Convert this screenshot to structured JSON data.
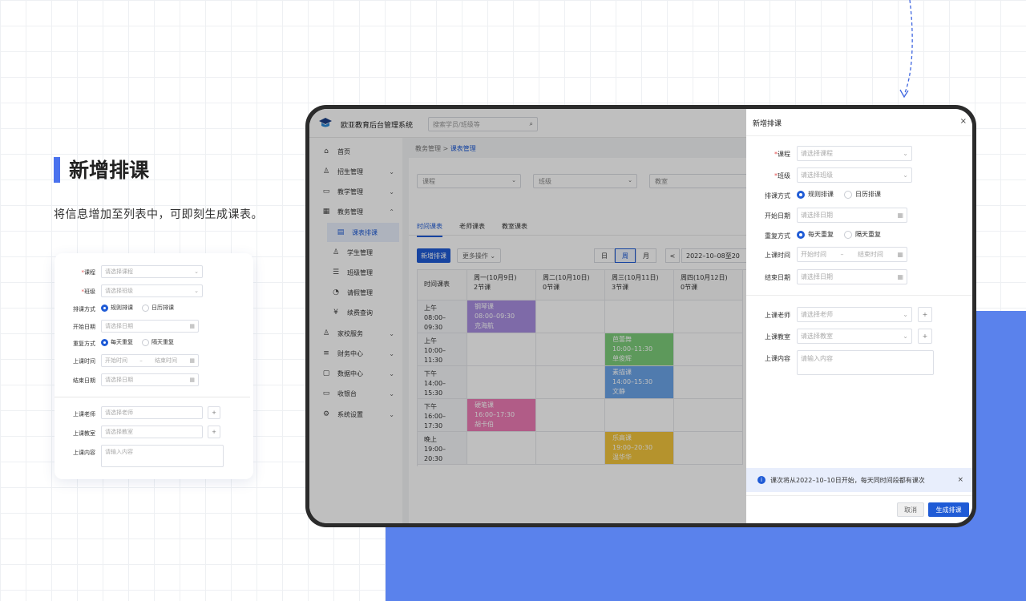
{
  "hero": {
    "title": "新增排课",
    "subtitle": "将信息增加至列表中，可即刻生成课表。"
  },
  "form": {
    "course_label": "课程",
    "course_ph": "请选择课程",
    "class_label": "班级",
    "class_ph": "请选择班级",
    "mode_label": "排课方式",
    "mode_rule": "规则排课",
    "mode_cal": "日历排课",
    "start_label": "开始日期",
    "start_ph": "请选择日期",
    "repeat_label": "重复方式",
    "repeat_daily": "每天重复",
    "repeat_alt": "隔天重复",
    "time_label": "上课时间",
    "time_start_ph": "开始时间",
    "time_sep": "–",
    "time_end_ph": "结束时间",
    "end_label": "结束日期",
    "end_ph": "请选择日期",
    "teacher_label": "上课老师",
    "teacher_ph": "请选择老师",
    "room_label": "上课教室",
    "room_ph": "请选择教室",
    "content_label": "上课内容",
    "content_ph": "请输入内容",
    "required_mark": "*",
    "plus": "+"
  },
  "app": {
    "name": "欧亚教育后台管理系统",
    "search_ph": "搜索学员/班级等",
    "nav": [
      {
        "label": "首页",
        "icon": "home-icon",
        "glyph": "⌂"
      },
      {
        "label": "招生管理",
        "icon": "user-add-icon",
        "glyph": "♙"
      },
      {
        "label": "教学管理",
        "icon": "book-icon",
        "glyph": "▭"
      },
      {
        "label": "教务管理",
        "icon": "blocks-icon",
        "glyph": "▦"
      },
      {
        "label": "课表排课",
        "icon": "calendar-icon",
        "glyph": "▤"
      },
      {
        "label": "学生管理",
        "icon": "person-icon",
        "glyph": "♙"
      },
      {
        "label": "班级管理",
        "icon": "list-icon",
        "glyph": "☰"
      },
      {
        "label": "请假管理",
        "icon": "leave-icon",
        "glyph": "◔"
      },
      {
        "label": "续费查询",
        "icon": "yen-icon",
        "glyph": "¥"
      },
      {
        "label": "家校服务",
        "icon": "group-icon",
        "glyph": "♙"
      },
      {
        "label": "财务中心",
        "icon": "database-icon",
        "glyph": "≡"
      },
      {
        "label": "数据中心",
        "icon": "frame-icon",
        "glyph": "▢"
      },
      {
        "label": "收银台",
        "icon": "monitor-icon",
        "glyph": "▭"
      },
      {
        "label": "系统设置",
        "icon": "gear-icon",
        "glyph": "⚙"
      }
    ],
    "breadcrumb_root": "教务管理",
    "breadcrumb_sep": ">",
    "breadcrumb_current": "课表管理",
    "filter_course": "课程",
    "filter_class": "班级",
    "filter_room": "教室",
    "tabs": [
      "时间课表",
      "老师课表",
      "教室课表"
    ],
    "new_btn": "新增排课",
    "more_btn": "更多操作",
    "views": [
      "日",
      "周",
      "月"
    ],
    "prev": "<",
    "date_range": "2022–10–08至20",
    "table_header": "时间课表",
    "days": [
      {
        "name": "周一(10月9日)",
        "count": "2节课"
      },
      {
        "name": "周二(10月10日)",
        "count": "0节课"
      },
      {
        "name": "周三(10月11日)",
        "count": "3节课"
      },
      {
        "name": "周四(10月12日)",
        "count": "0节课"
      }
    ],
    "slots": [
      {
        "period": "上午",
        "time": "08:00–09:30"
      },
      {
        "period": "上午",
        "time": "10:00–11:30"
      },
      {
        "period": "下午",
        "time": "14:00–15:30"
      },
      {
        "period": "下午",
        "time": "16:00–17:30"
      },
      {
        "period": "晚上",
        "time": "19:00–20:30"
      }
    ],
    "events": [
      {
        "name": "钢琴课",
        "time": "08:00–09:30",
        "teacher": "克海航",
        "color": "#a88ee0",
        "day": 0,
        "slot": 0
      },
      {
        "name": "芭蕾舞",
        "time": "10:00–11:30",
        "teacher": "单俊辉",
        "color": "#7ccc7a",
        "day": 2,
        "slot": 1
      },
      {
        "name": "素描课",
        "time": "14:00–15:30",
        "teacher": "文静",
        "color": "#6ba4e9",
        "day": 2,
        "slot": 2
      },
      {
        "name": "硬笔课",
        "time": "16:00–17:30",
        "teacher": "胡卡伯",
        "color": "#ec7bb5",
        "day": 0,
        "slot": 3
      },
      {
        "name": "乐高课",
        "time": "19:00–20:30",
        "teacher": "温华华",
        "color": "#f2c53d",
        "day": 2,
        "slot": 4
      }
    ]
  },
  "drawer": {
    "title": "新增排课",
    "close": "×",
    "notice": "课次将从2022–10–10日开始，每天同时间段都有课次",
    "notice_icon": "i",
    "cancel": "取消",
    "submit": "生成排课"
  }
}
